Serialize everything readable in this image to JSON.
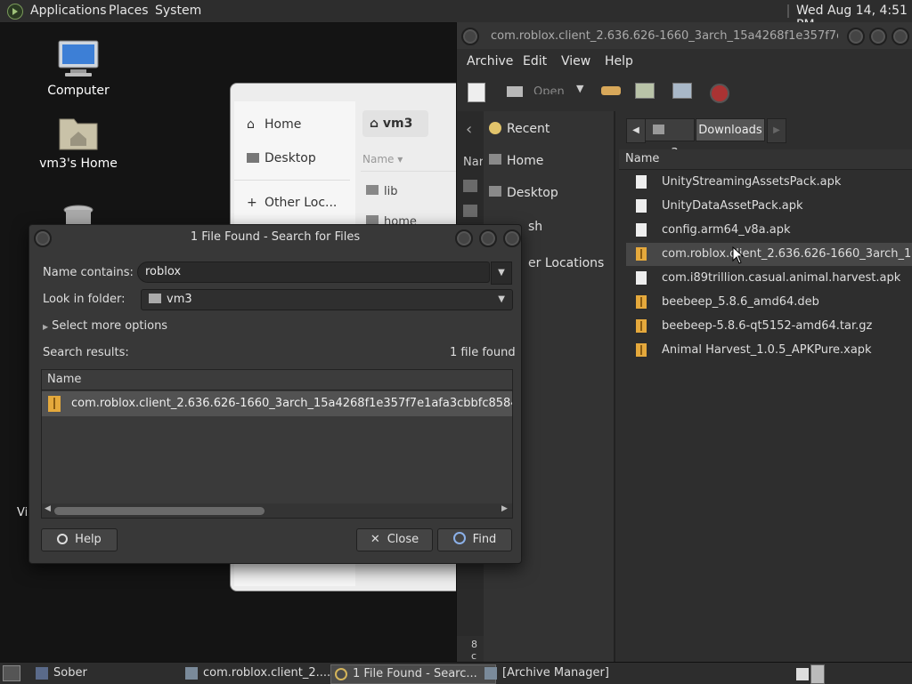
{
  "top_panel": {
    "menus": [
      "Applications",
      "Places",
      "System"
    ],
    "clock": "Wed Aug 14,  4:51 PM"
  },
  "desktop": {
    "icons": [
      "Computer",
      "vm3's Home"
    ],
    "partial_label": "Vis"
  },
  "files_window": {
    "sidebar": [
      "Home",
      "Desktop",
      "Other Loc..."
    ],
    "path_button": "vm3",
    "column_header": "Name",
    "items": [
      "lib",
      "home"
    ]
  },
  "archive_manager": {
    "title": "com.roblox.client_2.636.626-1660_3arch_15a4268f1e357f7e...",
    "menus": [
      "Archive",
      "Edit",
      "View",
      "Help"
    ],
    "toolbar_open": "Open",
    "places": [
      "Recent",
      "Home",
      "Desktop",
      "Trash",
      "Other Locations"
    ],
    "places_partial": [
      "sh",
      "er Locations"
    ],
    "left_header_partial": "Nar",
    "path": [
      "vm3",
      "Downloads"
    ],
    "column_header": "Name",
    "files": [
      "UnityStreamingAssetsPack.apk",
      "UnityDataAssetPack.apk",
      "config.arm64_v8a.apk",
      "com.roblox.client_2.636.626-1660_3arch_15a42",
      "com.i89trillion.casual.animal.harvest.apk",
      "beebeep_5.8.6_amd64.deb",
      "beebeep-5.8.6-qt5152-amd64.tar.gz",
      "Animal Harvest_1.0.5_APKPure.xapk"
    ],
    "status_partial": "8 c"
  },
  "search_dialog": {
    "title": "1 File Found - Search for Files",
    "name_label": "Name contains:",
    "name_value": "roblox",
    "folder_label": "Look in folder:",
    "folder_value": "vm3",
    "more_options": "Select more options",
    "results_label": "Search results:",
    "results_count": "1 file found",
    "column_header": "Name",
    "result_row": "com.roblox.client_2.636.626-1660_3arch_15a4268f1e357f7e1afa3cbbfc8584e9_ap",
    "help_label": "Help",
    "close_label": "Close",
    "find_label": "Find"
  },
  "taskbar": {
    "tasks": [
      "Sober",
      "com.roblox.client_2....",
      "1 File Found - Searc...",
      "[Archive Manager]"
    ]
  },
  "colors": {
    "folder_yellow": "#e5a93c",
    "selection": "#474747",
    "panel": "#2d2d2d"
  }
}
